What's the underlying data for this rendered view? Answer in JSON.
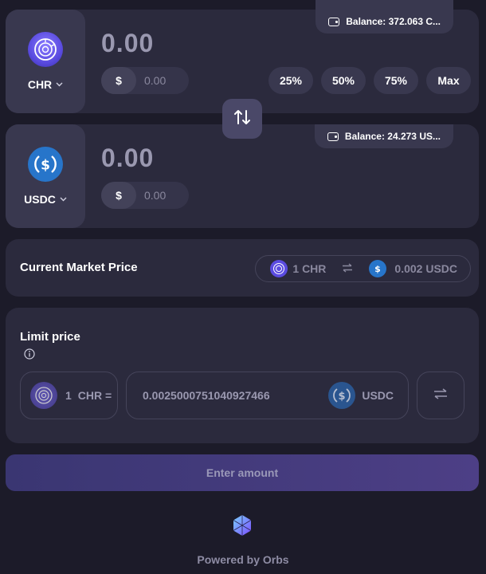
{
  "from": {
    "token": "CHR",
    "amount": "0.00",
    "usd_symbol": "$",
    "usd_value": "0.00",
    "balance": "Balance: 372.063 C...",
    "percent_buttons": [
      "25%",
      "50%",
      "75%",
      "Max"
    ]
  },
  "to": {
    "token": "USDC",
    "amount": "0.00",
    "usd_symbol": "$",
    "usd_value": "0.00",
    "balance": "Balance: 24.273 US..."
  },
  "market": {
    "label": "Current Market Price",
    "from_amount": "1 CHR",
    "to_amount": "0.002 USDC"
  },
  "limit": {
    "label": "Limit price",
    "from_qty": "1",
    "from_token": "CHR =",
    "price": "0.0025000751040927466",
    "to_token": "USDC"
  },
  "action_button": "Enter amount",
  "footer": "Powered by Orbs",
  "colors": {
    "background": "#1c1b29",
    "card": "#2b2a3d",
    "usdc_blue": "#2775ca",
    "chr_purple": "#6b5bff",
    "button_gradient": "#3a3672"
  },
  "icons": {
    "wallet": "wallet-icon",
    "swap": "swap-arrows-icon",
    "info": "info-icon",
    "exchange": "exchange-icon",
    "chevron": "chevron-down-icon"
  }
}
